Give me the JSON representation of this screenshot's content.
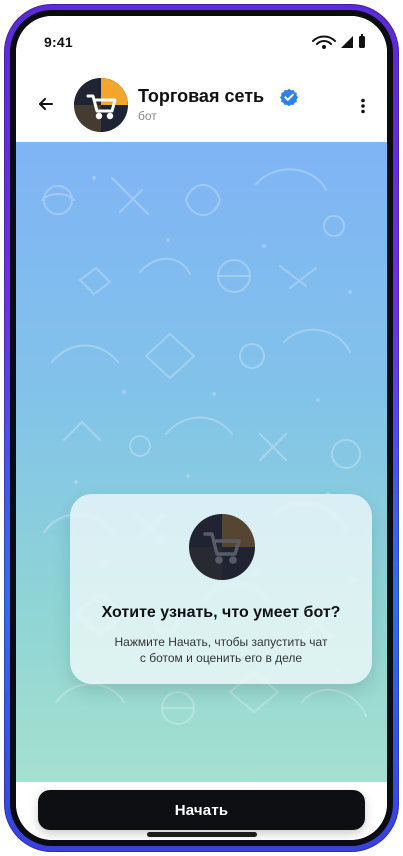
{
  "status_bar": {
    "time": "9:41"
  },
  "header": {
    "title": "Торговая сеть",
    "subtitle": "бот"
  },
  "card": {
    "title": "Хотите узнать, что умеет бот?",
    "description": "Нажмите Начать, чтобы запустить чат\nс ботом и оценить его в деле"
  },
  "bottom": {
    "start_label": "Начать"
  },
  "icons": {
    "back": "back-arrow-icon",
    "menu": "more-vert-icon",
    "verified": "verified-badge-icon",
    "avatar": "shopping-cart-avatar",
    "signal": "signal-icon",
    "wifi": "wifi-icon",
    "battery": "battery-icon"
  },
  "colors": {
    "accent_orange": "#f4a52b",
    "verified_blue": "#2f80ed",
    "primary_button": "#0e0f12"
  }
}
